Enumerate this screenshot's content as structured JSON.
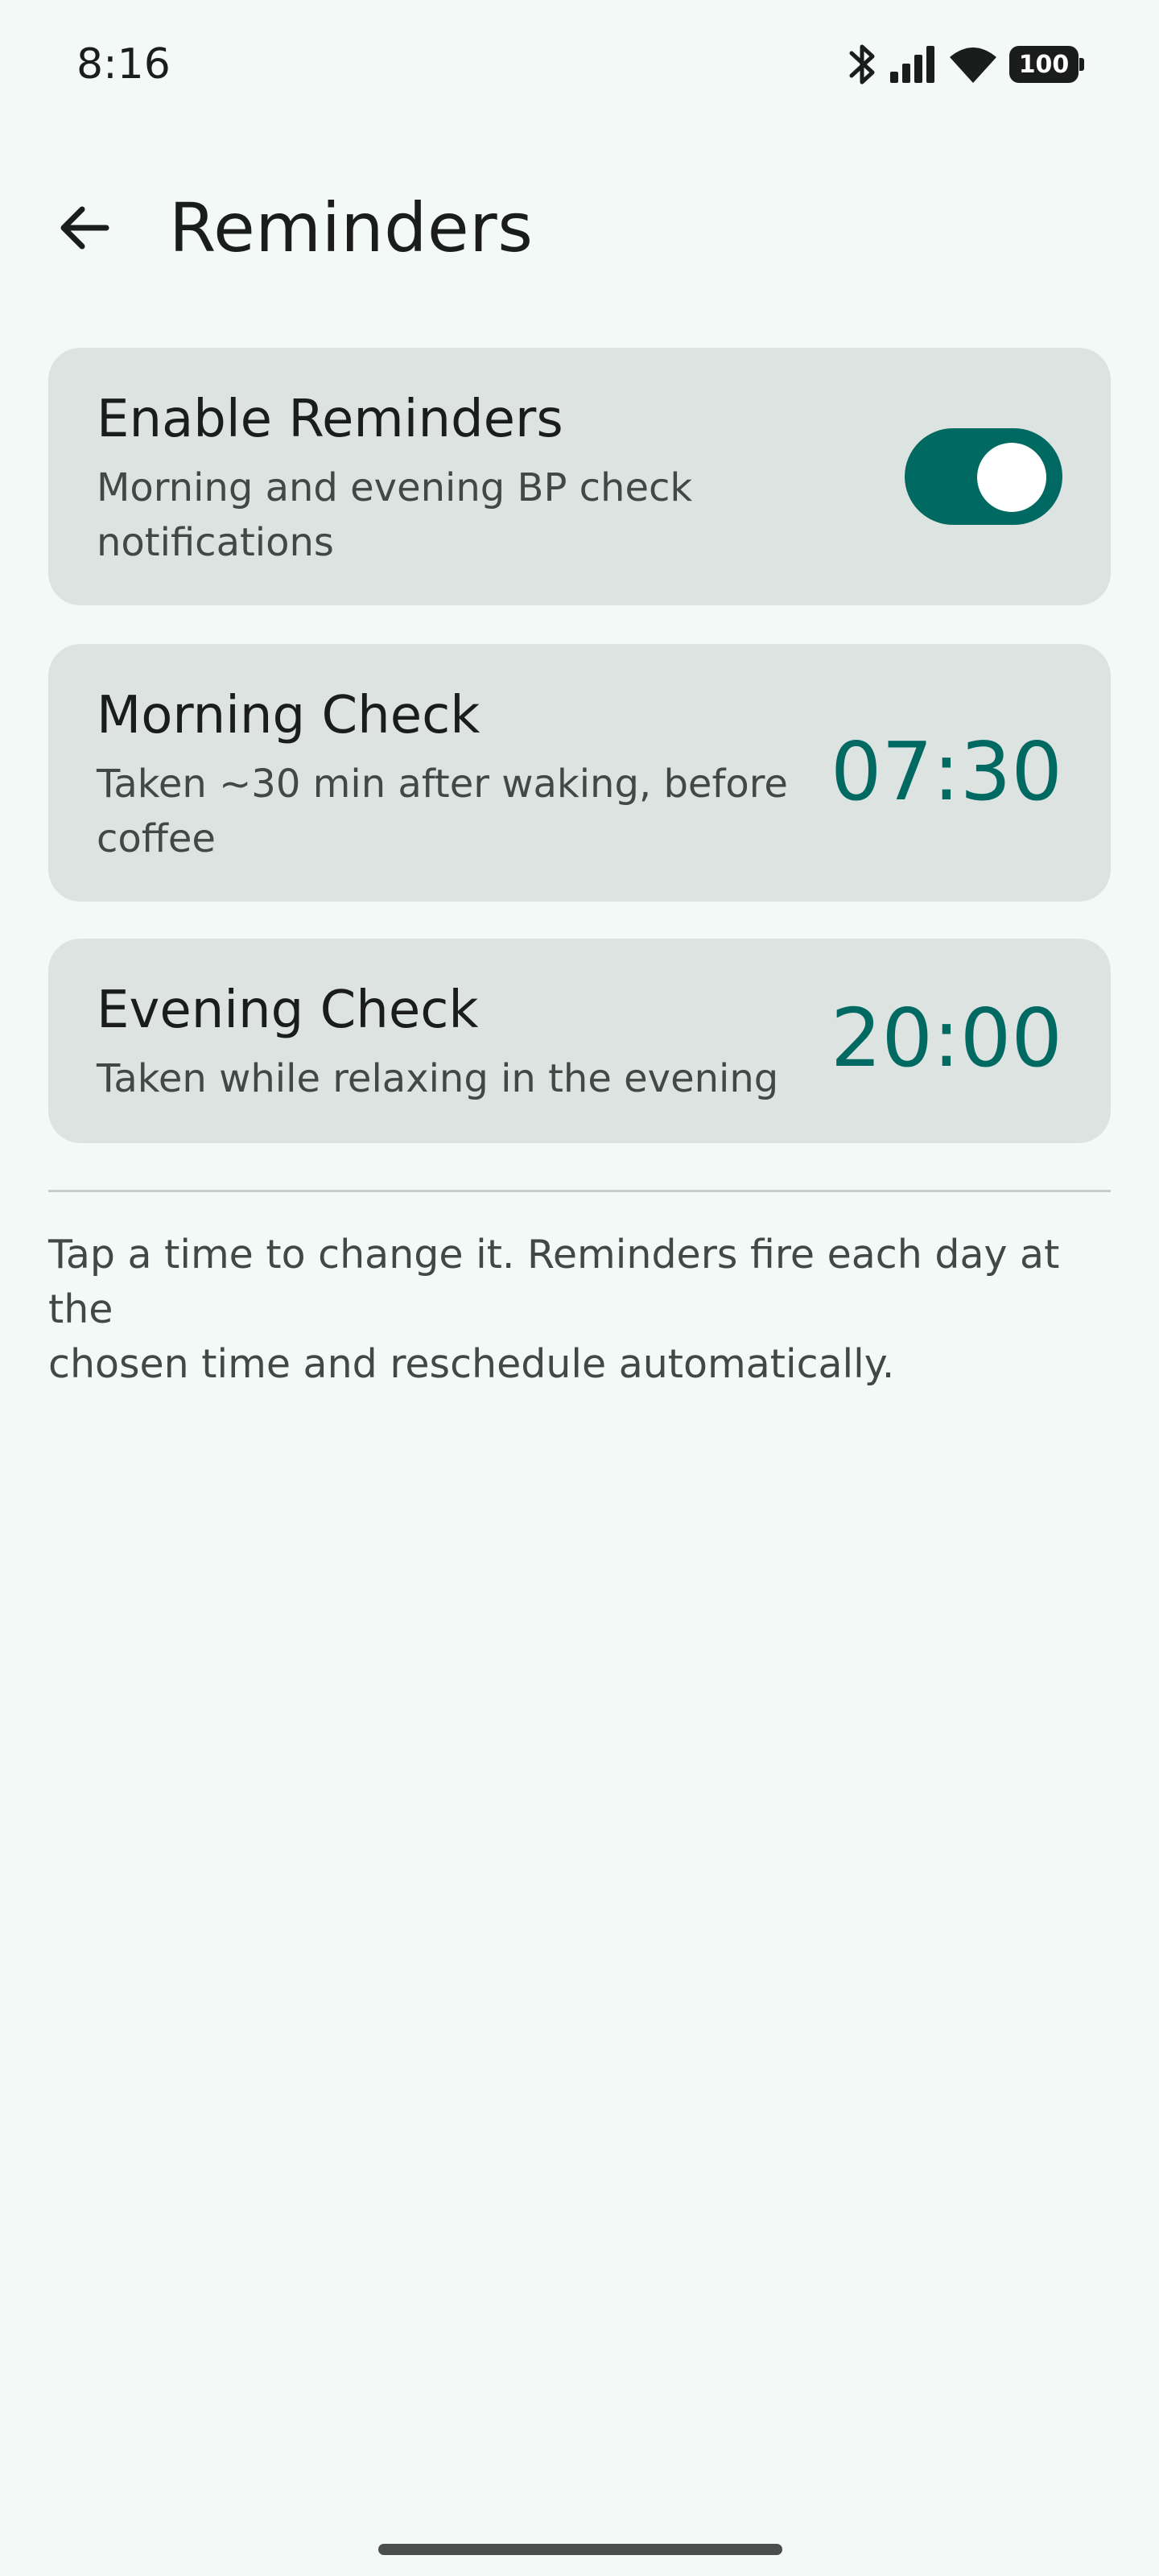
{
  "status_bar": {
    "time": "8:16",
    "battery": "100",
    "icons": [
      "bluetooth-icon",
      "signal-icon",
      "wifi-icon",
      "battery-icon"
    ]
  },
  "app_bar": {
    "title": "Reminders",
    "back_icon": "arrow-left-icon"
  },
  "enable_card": {
    "title": "Enable Reminders",
    "subtitle_line1": "Morning and evening BP check",
    "subtitle_line2": "notifications",
    "enabled": true
  },
  "morning_card": {
    "title": "Morning Check",
    "subtitle_line1": "Taken ~30 min after waking, before",
    "subtitle_line2": "coffee",
    "time": "07:30"
  },
  "evening_card": {
    "title": "Evening Check",
    "subtitle": "Taken while relaxing in the evening",
    "time": "20:00"
  },
  "footer": {
    "line1": "Tap a time to change it. Reminders fire each day at the",
    "line2": "chosen time and reschedule automatically."
  },
  "colors": {
    "background": "#f3f9f7",
    "card": "#dde3e1",
    "accent": "#006a62"
  }
}
